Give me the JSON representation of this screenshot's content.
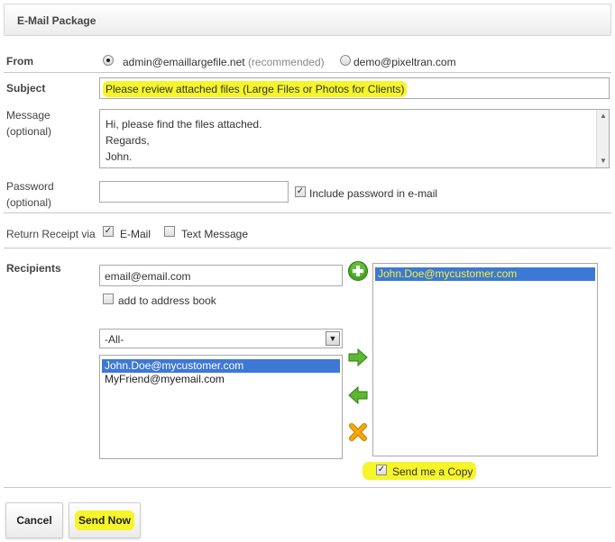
{
  "title": "E-Mail Package",
  "from": {
    "label": "From",
    "option1": "admin@emaillargefile.net",
    "option1_note": "(recommended)",
    "option2": "demo@pixeltran.com",
    "selected": "option1"
  },
  "subject": {
    "label": "Subject",
    "value": "Please review attached files (Large Files or Photos for Clients)"
  },
  "message": {
    "label_line1": "Message",
    "label_line2": "(optional)",
    "lines": [
      "Hi, please find the files attached.",
      "Regards,",
      "John."
    ]
  },
  "password": {
    "label_line1": "Password",
    "label_line2": "(optional)",
    "value": "",
    "include_label": "Include password in e-mail",
    "include_checked": true
  },
  "receipt": {
    "label": "Return Receipt via",
    "email_label": "E-Mail",
    "email_checked": true,
    "text_label": "Text Message",
    "text_checked": false
  },
  "recipients": {
    "label": "Recipients",
    "email_value": "email@email.com",
    "add_book_label": "add to address book",
    "add_book_checked": false,
    "group_selected": "-All-",
    "address_list": [
      "John.Doe@mycustomer.com",
      "MyFriend@myemail.com"
    ],
    "selected_list": [
      "John.Doe@mycustomer.com"
    ],
    "send_copy_label": "Send me a Copy",
    "send_copy_checked": true
  },
  "icons": {
    "add": "plus-circle-icon",
    "move_right": "arrow-right-icon",
    "move_left": "arrow-left-icon",
    "remove": "x-icon"
  },
  "colors": {
    "highlight": "#f5f52a",
    "selection": "#3d78d6",
    "green_icon": "#46a623",
    "orange_icon": "#f0a000"
  },
  "buttons": {
    "cancel": "Cancel",
    "send_now": "Send Now"
  }
}
